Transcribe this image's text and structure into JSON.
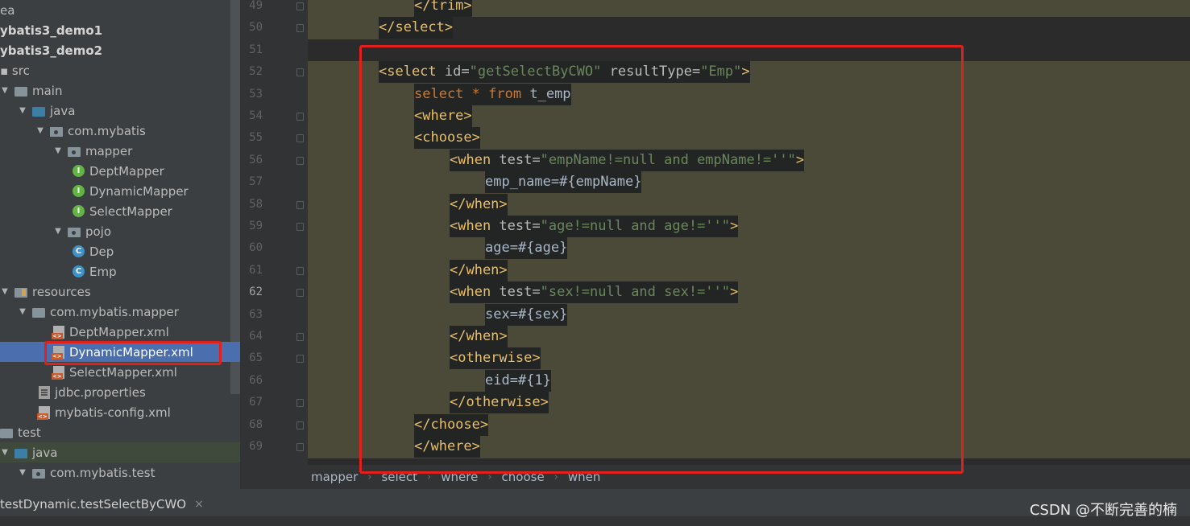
{
  "tree": {
    "items": [
      {
        "label": "ea"
      },
      {
        "label": "ybatis3_demo1"
      },
      {
        "label": "ybatis3_demo2"
      },
      {
        "label": "src"
      },
      {
        "label": "main"
      },
      {
        "label": "java"
      },
      {
        "label": "com.mybatis"
      },
      {
        "label": "mapper"
      },
      {
        "label": "DeptMapper"
      },
      {
        "label": "DynamicMapper"
      },
      {
        "label": "SelectMapper"
      },
      {
        "label": "pojo"
      },
      {
        "label": "Dep"
      },
      {
        "label": "Emp"
      },
      {
        "label": "resources"
      },
      {
        "label": "com.mybatis.mapper"
      },
      {
        "label": "DeptMapper.xml"
      },
      {
        "label": "DynamicMapper.xml"
      },
      {
        "label": "SelectMapper.xml"
      },
      {
        "label": "jdbc.properties"
      },
      {
        "label": "mybatis-config.xml"
      },
      {
        "label": "test"
      },
      {
        "label": "java"
      },
      {
        "label": "com.mybatis.test"
      }
    ]
  },
  "editor": {
    "current_line": "62",
    "lines": [
      {
        "n": "49",
        "parts": [
          [
            "t",
            "</trim>"
          ]
        ]
      },
      {
        "n": "50",
        "parts": [
          [
            "t",
            "</select>"
          ]
        ]
      },
      {
        "n": "51",
        "parts": []
      },
      {
        "n": "52",
        "parts": [
          [
            "t",
            "<select "
          ],
          [
            "a",
            "id="
          ],
          [
            "s",
            "\"getSelectByCWO\""
          ],
          [
            "a",
            " resultType="
          ],
          [
            "s",
            "\"Emp\""
          ],
          [
            "t",
            ">"
          ]
        ]
      },
      {
        "n": "53",
        "parts": [
          [
            "k",
            "select"
          ],
          [
            "tx",
            " "
          ],
          [
            "k",
            "*"
          ],
          [
            "tx",
            " "
          ],
          [
            "k",
            "from"
          ],
          [
            "tx",
            " t_emp"
          ]
        ]
      },
      {
        "n": "54",
        "parts": [
          [
            "t",
            "<where>"
          ]
        ]
      },
      {
        "n": "55",
        "parts": [
          [
            "t",
            "<choose>"
          ]
        ]
      },
      {
        "n": "56",
        "parts": [
          [
            "t",
            "<when "
          ],
          [
            "a",
            "test="
          ],
          [
            "s",
            "\"empName!=null and empName!=''\""
          ],
          [
            "t",
            ">"
          ]
        ]
      },
      {
        "n": "57",
        "parts": [
          [
            "tx",
            "emp_name=#{empName}"
          ]
        ]
      },
      {
        "n": "58",
        "parts": [
          [
            "t",
            "</when>"
          ]
        ]
      },
      {
        "n": "59",
        "parts": [
          [
            "t",
            "<when "
          ],
          [
            "a",
            "test="
          ],
          [
            "s",
            "\"age!=null and age!=''\""
          ],
          [
            "t",
            ">"
          ]
        ]
      },
      {
        "n": "60",
        "parts": [
          [
            "tx",
            "age=#{age}"
          ]
        ]
      },
      {
        "n": "61",
        "parts": [
          [
            "t",
            "</when>"
          ]
        ]
      },
      {
        "n": "62",
        "parts": [
          [
            "t",
            "<when "
          ],
          [
            "a",
            "test="
          ],
          [
            "s",
            "\"sex!=null and sex!=''\""
          ],
          [
            "t",
            ">"
          ]
        ]
      },
      {
        "n": "63",
        "parts": [
          [
            "tx",
            "sex=#{sex}"
          ]
        ]
      },
      {
        "n": "64",
        "parts": [
          [
            "t",
            "</when>"
          ]
        ]
      },
      {
        "n": "65",
        "parts": [
          [
            "t",
            "<otherwise>"
          ]
        ]
      },
      {
        "n": "66",
        "parts": [
          [
            "tx",
            "eid=#{1}"
          ]
        ]
      },
      {
        "n": "67",
        "parts": [
          [
            "t",
            "</otherwise>"
          ]
        ]
      },
      {
        "n": "68",
        "parts": [
          [
            "t",
            "</choose>"
          ]
        ]
      },
      {
        "n": "69",
        "parts": [
          [
            "t",
            "</where>"
          ]
        ]
      }
    ]
  },
  "breadcrumb": [
    "mapper",
    "select",
    "where",
    "choose",
    "when"
  ],
  "run_tab": {
    "label": "testDynamic.testSelectByCWO",
    "close": "×"
  },
  "watermark": "CSDN @不断完善的楠",
  "colors": {
    "tag": "#e8bf6a",
    "attr": "#bababa",
    "string": "#6a8759",
    "keyword": "#cc7832",
    "highlight": "#4b4a38",
    "selection": "#4b6eaf",
    "annotation": "#e1201c"
  }
}
